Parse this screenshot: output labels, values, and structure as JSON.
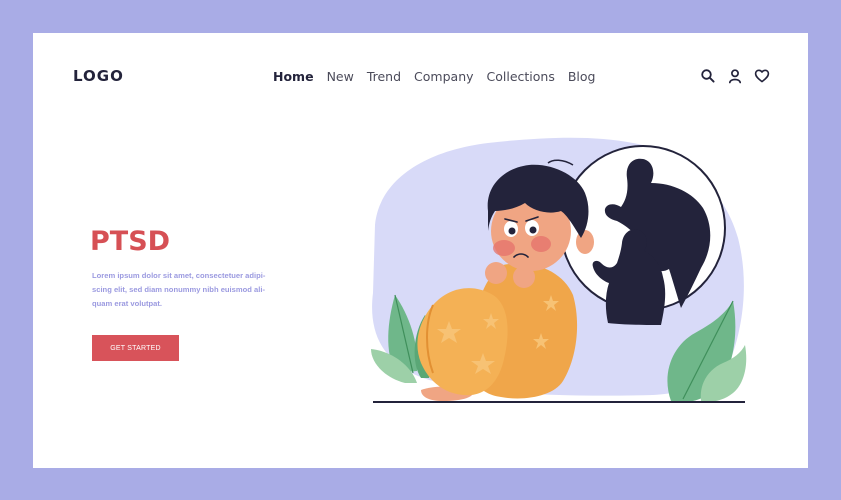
{
  "header": {
    "logo": "LOGO",
    "nav": [
      "Home",
      "New",
      "Trend",
      "Company",
      "Collections",
      "Blog"
    ],
    "active_nav": "Home",
    "icons": [
      "search-icon",
      "user-icon",
      "heart-icon"
    ]
  },
  "hero": {
    "title": "PTSD",
    "description": "Lorem ipsum dolor sit amet, consectetuer adipi-scing elit, sed diam nonummy nibh euismod ali-quam erat volutpat.",
    "cta": "GET STARTED"
  },
  "colors": {
    "page_background": "#a9ace6",
    "card_background": "#ffffff",
    "accent": "#d65055",
    "text_secondary": "#9b9ae0",
    "dark": "#23233b",
    "blob": "#d8daf8",
    "leaf": "#6fb78a",
    "sweater": "#f0a64a"
  }
}
